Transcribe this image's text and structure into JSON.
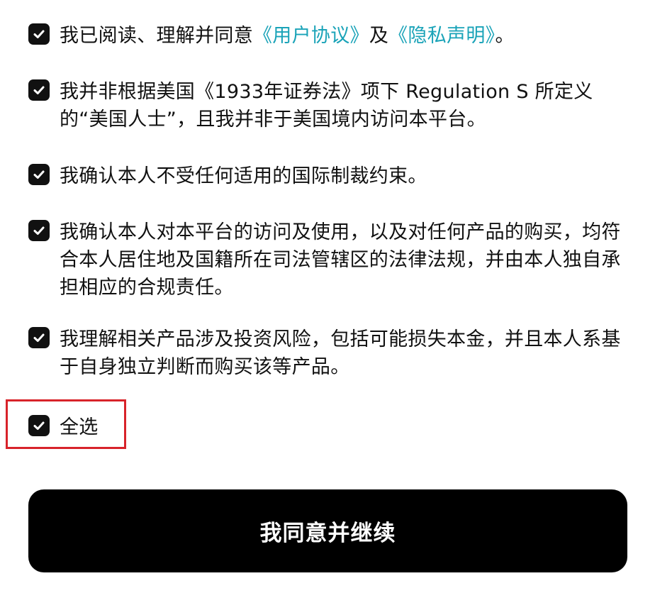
{
  "consents": [
    {
      "prefix": "我已阅读、理解并同意",
      "link1": "《用户协议》",
      "middle": "及",
      "link2": "《隐私声明》",
      "suffix": "。",
      "checked": true
    },
    {
      "text": "我并非根据美国《1933年证券法》项下 Regulation S 所定义的“美国人士”，且我并非于美国境内访问本平台。",
      "checked": true
    },
    {
      "text": "我确认本人不受任何适用的国际制裁约束。",
      "checked": true
    },
    {
      "text": "我确认本人对本平台的访问及使用，以及对任何产品的购买，均符合本人居住地及国籍所在司法管辖区的法律法规，并由本人独自承担相应的合规责任。",
      "checked": true
    },
    {
      "text": "我理解相关产品涉及投资风险，包括可能损失本金，并且本人系基于自身独立判断而购买该等产品。",
      "checked": true
    }
  ],
  "select_all": {
    "label": "全选",
    "checked": true
  },
  "agree_button": {
    "label": "我同意并继续"
  },
  "colors": {
    "link": "#1aa3b8",
    "highlight": "#d8232a",
    "button_bg": "#000000"
  }
}
